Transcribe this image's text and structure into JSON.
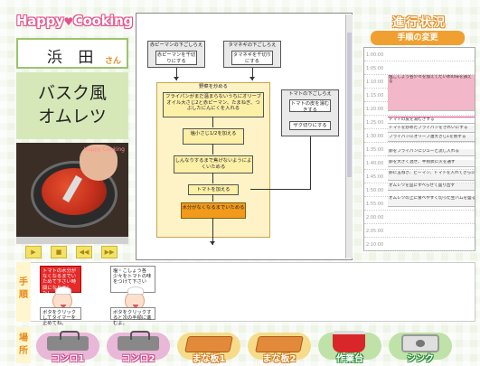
{
  "app": {
    "logo_text_a": "Happy",
    "logo_heart": "♥",
    "logo_text_b": "Cooking",
    "user_name": "浜 田",
    "user_suffix": "さん",
    "recipe_line1": "バスク風",
    "recipe_line2": "オムレツ"
  },
  "video": {
    "overlay_tag": "Happy Cooking",
    "controls": [
      "▶",
      "■",
      "◀◀",
      "▶▶"
    ]
  },
  "flowchart": {
    "col1_title": "赤ピーマンの下ごしらえ",
    "col1_step": "赤ピーマンを千切りにする",
    "col2_title": "タマネギの下ごしらえ",
    "col2_step": "タマネギを千切りにする",
    "main_title": "野菜を炒める",
    "main_step1": "フライパンがまだ温まらないうちにオリーブオイル大さじ2と赤ピーマン、たまねぎ、つぶしたにんにくを入れる",
    "main_step2": "塩小さじ1/2を加える",
    "main_step3": "しんなりするまで焦げないようによくいためる",
    "main_step4": "トマトを加える",
    "main_step5": "水分がなくなるまでいためる",
    "tomato_title": "トマトの下ごしらえ",
    "tomato_step1": "トマトの皮を湯むきする",
    "tomato_step2": "ザク切りにする"
  },
  "progress": {
    "title": "進行状況",
    "subtitle": "手順の変更",
    "times": [
      "1:00:00",
      "1:05:00",
      "1:10:00",
      "1:15:00",
      "1:20:00",
      "1:25:00",
      "1:30:00",
      "1:35:00",
      "1:40:00",
      "1:45:00",
      "1:50:00",
      "1:55:00",
      "2:00:00",
      "2:05:00",
      "2:10:00"
    ],
    "events": [
      {
        "text": "塩こしょう各少々を加えてたいめの味を調える",
        "kind": "pink"
      },
      {
        "text": "ドマトの皮を湯むきする",
        "kind": "mag"
      },
      {
        "text": "トマトを炒めたフライパンをきれいにする",
        "kind": "plain"
      },
      {
        "text": "フライパンにオリーブ油大さじ1を熱する",
        "kind": "plain"
      },
      {
        "text": "卵をフライパンにジューと流し入れる",
        "kind": "plain"
      },
      {
        "text": "卵を大きく混ぜ、半熟状に火を通す",
        "kind": "plain"
      },
      {
        "text": "卵に玉ねぎ、ピーマン、トマトを入れてさらに軽く混ぜてまとめる",
        "kind": "plain"
      },
      {
        "text": "オムレツを皿にすべらせて盛り出す",
        "kind": "plain"
      },
      {
        "text": "オムレツの上に食べやすく切った生ハムを盛る",
        "kind": "plain"
      }
    ]
  },
  "steps": {
    "label": "手順",
    "bubble1": "トマトの水分がなくなるまでいためて下さい時間になりました！",
    "bubble2": "塩・こしょう各少々をトマトの味をつけて下さい",
    "hint1": "ボタをクリックしてタイマーを止めてね。",
    "hint2": "ボタをクリックすると次の手順に進むよ。"
  },
  "places": {
    "label": "場所",
    "items": [
      {
        "label": "コンロ1",
        "kind": "stove",
        "color": "#e9b7d8"
      },
      {
        "label": "コンロ2",
        "kind": "stove",
        "color": "#e9b7d8"
      },
      {
        "label": "まな板1",
        "kind": "board",
        "color": "#f6dc8a"
      },
      {
        "label": "まな板2",
        "kind": "board",
        "color": "#f6dc8a"
      },
      {
        "label": "作業台",
        "kind": "pot",
        "color": "#bfe2a8"
      },
      {
        "label": "シンク",
        "kind": "sink",
        "color": "#bfe2a8"
      }
    ]
  }
}
